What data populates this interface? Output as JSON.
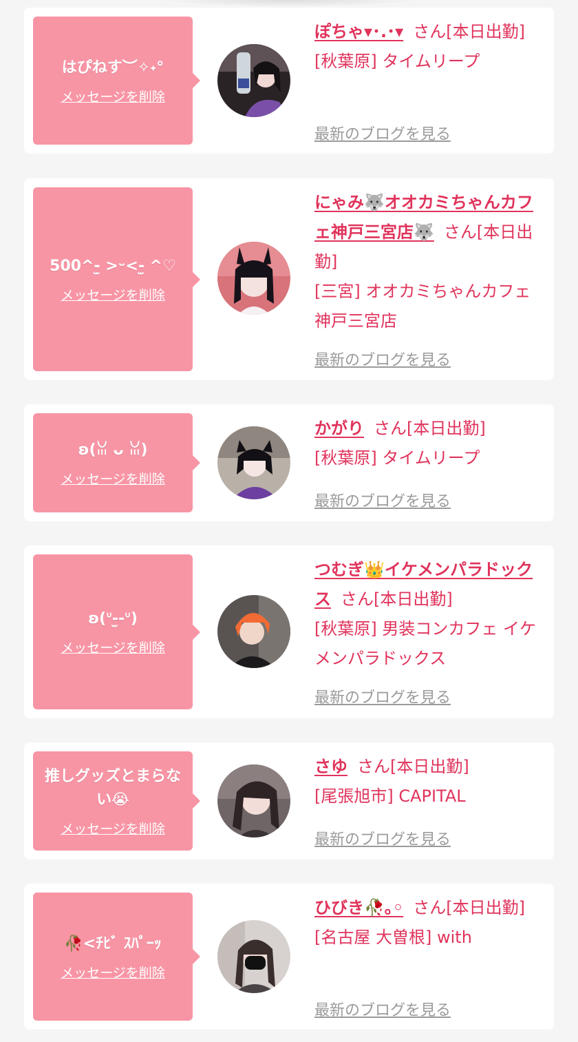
{
  "delete_label": "メッセージを削除",
  "blog_label": "最新のブログを見る",
  "cards": [
    {
      "message": "はぴねす︶✧˖°",
      "name": "ぽちゃ▾･.･▾",
      "honorific": "さん",
      "status": "[本日出勤]",
      "location": "[秋葉原] タイムリープ"
    },
    {
      "message": "500^-̫ >ᵕ<-̫ ^♡",
      "name": "にゃみ🐺オオカミちゃんカフェ神戸三宮店🐺",
      "honorific": "さん",
      "status": "[本日出勤]",
      "location": "[三宮] オオカミちゃんカフェ神戸三宮店"
    },
    {
      "message": "ʚ(ꈍ ᴗ ꈍ)",
      "name": "かがり",
      "honorific": "さん",
      "status": "[本日出勤]",
      "location": "[秋葉原] タイムリープ"
    },
    {
      "message": "ʚ(ᐡ-̫-ᐡ)",
      "name": "つむぎ👑イケメンパラドックス",
      "honorific": "さん",
      "status": "[本日出勤]",
      "location": "[秋葉原] 男装コンカフェ イケメンパラドックス"
    },
    {
      "message": "推しグッズとまらない😭",
      "name": "さゆ",
      "honorific": "さん",
      "status": "[本日出勤]",
      "location": "[尾張旭市] CAPITAL"
    },
    {
      "message": "🥀<ﾁﾋﾞ ｽﾊﾟｰｯ",
      "name": "ひびき🥀｡◦",
      "honorific": "さん",
      "status": "[本日出勤]",
      "location": "[名古屋 大曽根] with"
    }
  ]
}
